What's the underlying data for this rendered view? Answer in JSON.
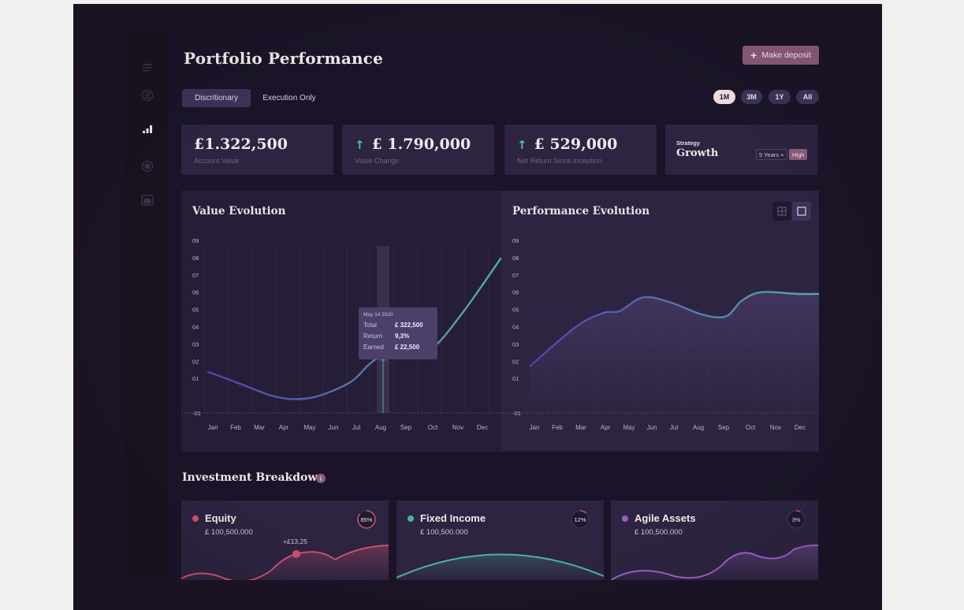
{
  "header": {
    "title": "Portfolio Performance",
    "deposit_label": "Make deposit"
  },
  "sidebar": {
    "items": [
      {
        "icon": "menu-icon"
      },
      {
        "icon": "user-icon"
      },
      {
        "icon": "bar-chart-icon",
        "active": true
      },
      {
        "icon": "target-icon"
      },
      {
        "icon": "wallet-icon"
      }
    ]
  },
  "tabs": [
    {
      "label": "Discritionary",
      "active": true
    },
    {
      "label": "Execution Only",
      "active": false
    }
  ],
  "periods": [
    {
      "label": "1M",
      "active": true
    },
    {
      "label": "3M",
      "active": false
    },
    {
      "label": "1Y",
      "active": false
    },
    {
      "label": "All",
      "active": false
    }
  ],
  "stats": {
    "account_value": "£1.322,500",
    "account_label": "Account Value",
    "value_change": "£ 1.790,000",
    "value_change_label": "Value Change",
    "net_return": "£ 529,000",
    "net_return_label": "Net Return Since Inception",
    "strategy_label": "Strategy",
    "strategy_value": "Growth",
    "strategy_term": "5 Years +",
    "strategy_risk": "High"
  },
  "charts": {
    "value_title": "Value Evolution",
    "performance_title": "Performance Evolution"
  },
  "tooltip": {
    "date": "May 14 2020",
    "rows": [
      {
        "label": "Total",
        "value": "£ 322,500"
      },
      {
        "label": "Return",
        "value": "9,3%"
      },
      {
        "label": "Earned",
        "value": "£ 22,500"
      }
    ]
  },
  "chart_data": [
    {
      "type": "line",
      "title": "Value Evolution",
      "x": [
        "Jan",
        "Feb",
        "Mar",
        "Apr",
        "May",
        "Jun",
        "Jul",
        "Aug",
        "Sep",
        "Oct",
        "Nov",
        "Dec"
      ],
      "y_ticks": [
        "09",
        "08",
        "07",
        "06",
        "05",
        "04",
        "03",
        "02",
        "01",
        "-01"
      ],
      "ylim": [
        -1,
        9
      ],
      "series": [
        {
          "values": [
            1.4,
            0.6,
            0.0,
            -0.2,
            0.0,
            0.8,
            1.8,
            2.3,
            2.35,
            2.8,
            5.0,
            8.0
          ]
        }
      ],
      "highlight": {
        "category": "Aug",
        "value": 2.3
      },
      "colors": {
        "start": "#5a3bb0",
        "end": "#4fb1a4"
      }
    },
    {
      "type": "area",
      "title": "Performance Evolution",
      "x": [
        "Jan",
        "Feb",
        "Mar",
        "Apr",
        "May",
        "Jun",
        "Jul",
        "Aug",
        "Sep",
        "Oct",
        "Nov",
        "Dec"
      ],
      "y_ticks": [
        "09",
        "08",
        "07",
        "06",
        "05",
        "04",
        "03",
        "02",
        "01",
        "-01"
      ],
      "ylim": [
        -1,
        9
      ],
      "series": [
        {
          "values": [
            1.7,
            4.0,
            4.8,
            4.9,
            5.7,
            5.4,
            4.7,
            4.6,
            5.5,
            6.0,
            5.9,
            5.9
          ]
        }
      ],
      "colors": {
        "start": "#5a3bb0",
        "end": "#4fb1a4"
      }
    }
  ],
  "breakdown": {
    "title": "Investment Breakdown",
    "info": "i",
    "items": [
      {
        "name": "Equity",
        "amount": "£ 100,500.000",
        "percent": "85%",
        "fraction": 0.85,
        "color": "#c9506f",
        "annotation": "+£13,25"
      },
      {
        "name": "Fixed Income",
        "amount": "£ 100,500.000",
        "percent": "12%",
        "fraction": 0.12,
        "color": "#4fb1a4"
      },
      {
        "name": "Agile Assets",
        "amount": "£ 100,500.000",
        "percent": "3%",
        "fraction": 0.03,
        "color": "#9a5fc2"
      }
    ]
  }
}
